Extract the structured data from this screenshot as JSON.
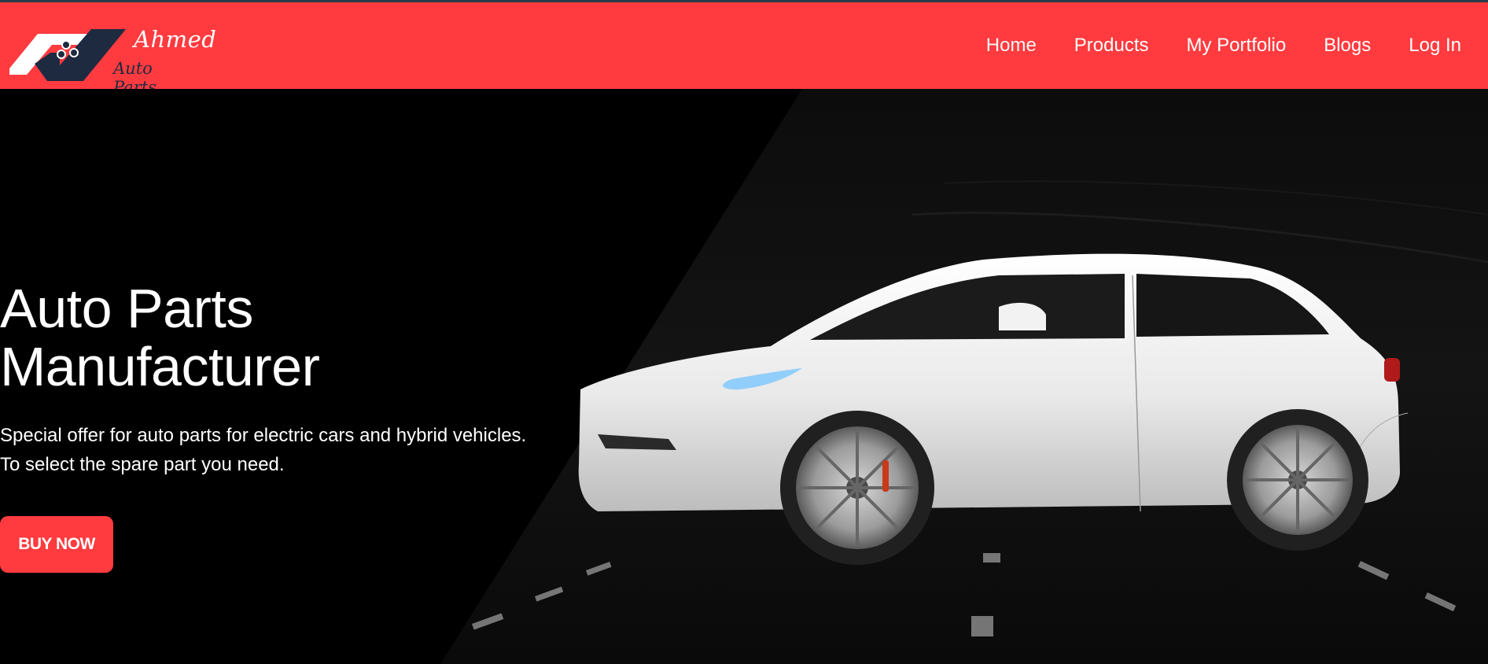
{
  "brand": {
    "name": "Ahmed",
    "subtitle": "Auto Parts",
    "colors": {
      "primary": "#ff3b3f",
      "navy": "#1e2a40"
    }
  },
  "nav": {
    "items": [
      {
        "label": "Home"
      },
      {
        "label": "Products"
      },
      {
        "label": "My Portfolio"
      },
      {
        "label": "Blogs"
      },
      {
        "label": "Log In"
      }
    ]
  },
  "hero": {
    "title_line1": "Auto Parts",
    "title_line2": "Manufacturer",
    "description": "Special offer for auto parts for electric cars and hybrid vehicles. To select the spare part you need.",
    "cta_label": "BUY NOW",
    "image": "white-electric-suv-on-road"
  }
}
